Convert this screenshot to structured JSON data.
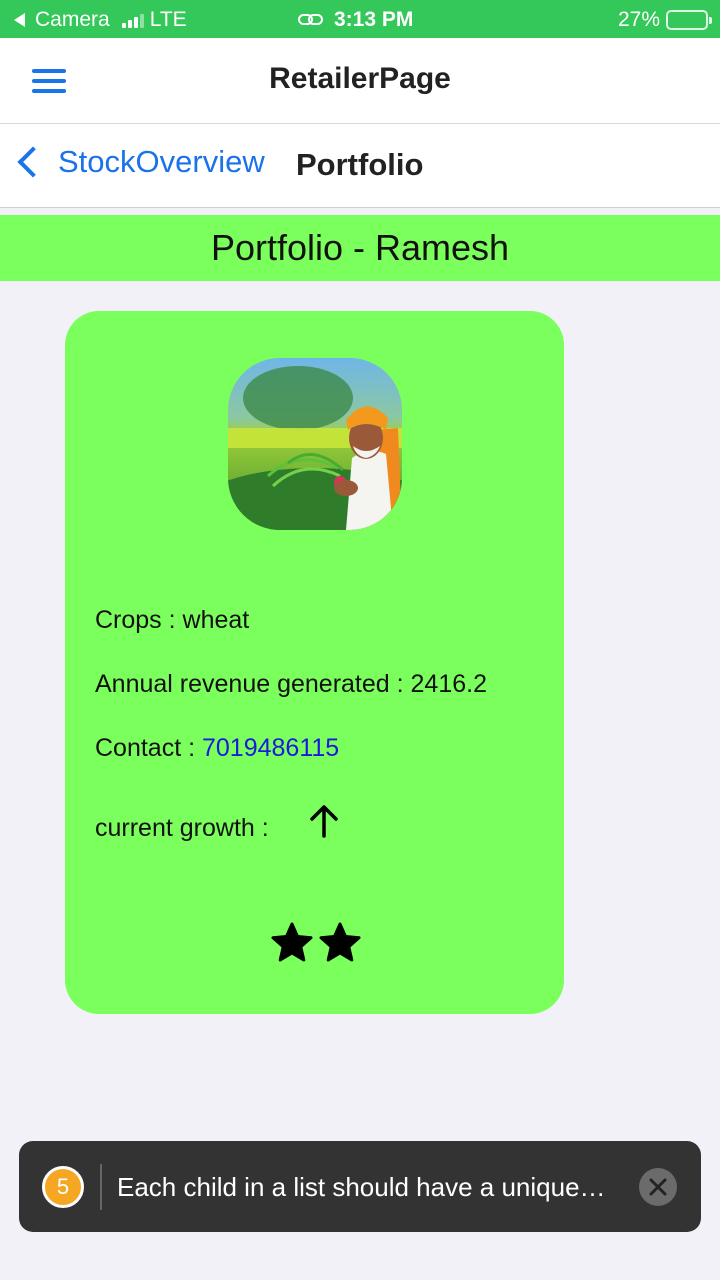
{
  "status_bar": {
    "back_app": "Camera",
    "network": "LTE",
    "time": "3:13 PM",
    "battery_percent": "27%",
    "battery_level": 0.27,
    "signal_bars": 3
  },
  "header": {
    "title": "RetailerPage",
    "menu_icon": "hamburger-menu-icon"
  },
  "nav": {
    "back_label": "StockOverview",
    "title": "Portfolio"
  },
  "banner": {
    "title": "Portfolio - Ramesh"
  },
  "card": {
    "crops_line": "Crops : wheat",
    "revenue_line": "Annual revenue generated : 2416.2",
    "contact_label": "Contact : ",
    "contact_number": "7019486115",
    "growth_label": "current growth :",
    "growth_icon": "arrow-up-icon",
    "rating": 2
  },
  "toast": {
    "count": "5",
    "message": "Each child in a list should have a unique…"
  },
  "colors": {
    "status_bar": "#34c759",
    "accent_blue": "#1a73e8",
    "card_green": "#7bff5c",
    "toast_bg": "#333333",
    "badge": "#f5a623"
  }
}
